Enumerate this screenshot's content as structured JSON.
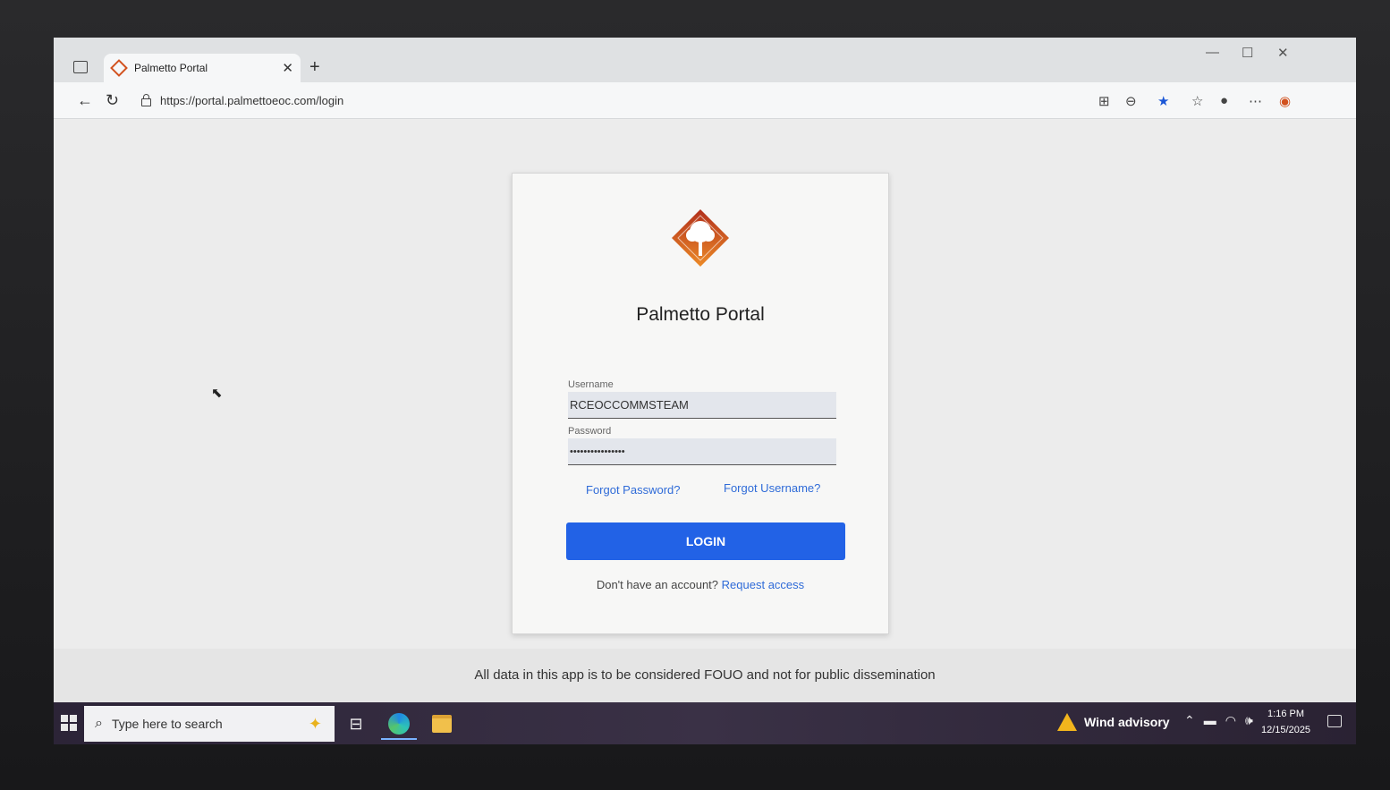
{
  "browser": {
    "tab_title": "Palmetto Portal",
    "close_tab": "✕",
    "new_tab": "+",
    "url": "https://portal.palmettoeoc.com/login",
    "back": "←",
    "reload": "↻",
    "minimize": "—",
    "maximize": "☐",
    "close": "✕"
  },
  "login": {
    "title": "Palmetto Portal",
    "username_label": "Username",
    "username_value": "RCEOCCOMMSTEAM",
    "password_label": "Password",
    "password_value": "••••••••••••••••",
    "forgot_password": "Forgot Password?",
    "forgot_username": "Forgot Username?",
    "login_button": "LOGIN",
    "no_account_text": "Don't have an account?",
    "request_access": "Request access"
  },
  "footer": {
    "notice": "All data in this app is to be considered FOUO and not for public dissemination"
  },
  "taskbar": {
    "search_placeholder": "Type here to search",
    "weather_alert": "Wind advisory",
    "time": "1:16 PM",
    "date": "12/15/2025"
  },
  "colors": {
    "primary_button": "#2262e6",
    "link": "#2f6bd8",
    "logo_orange": "#d2511e"
  },
  "icons": [
    "sidebar-toggle-icon",
    "palmetto-logo-icon",
    "lock-icon",
    "back-icon",
    "reload-icon",
    "star-icon",
    "search-icon",
    "edge-icon",
    "folder-icon",
    "warning-icon",
    "windows-start-icon"
  ]
}
